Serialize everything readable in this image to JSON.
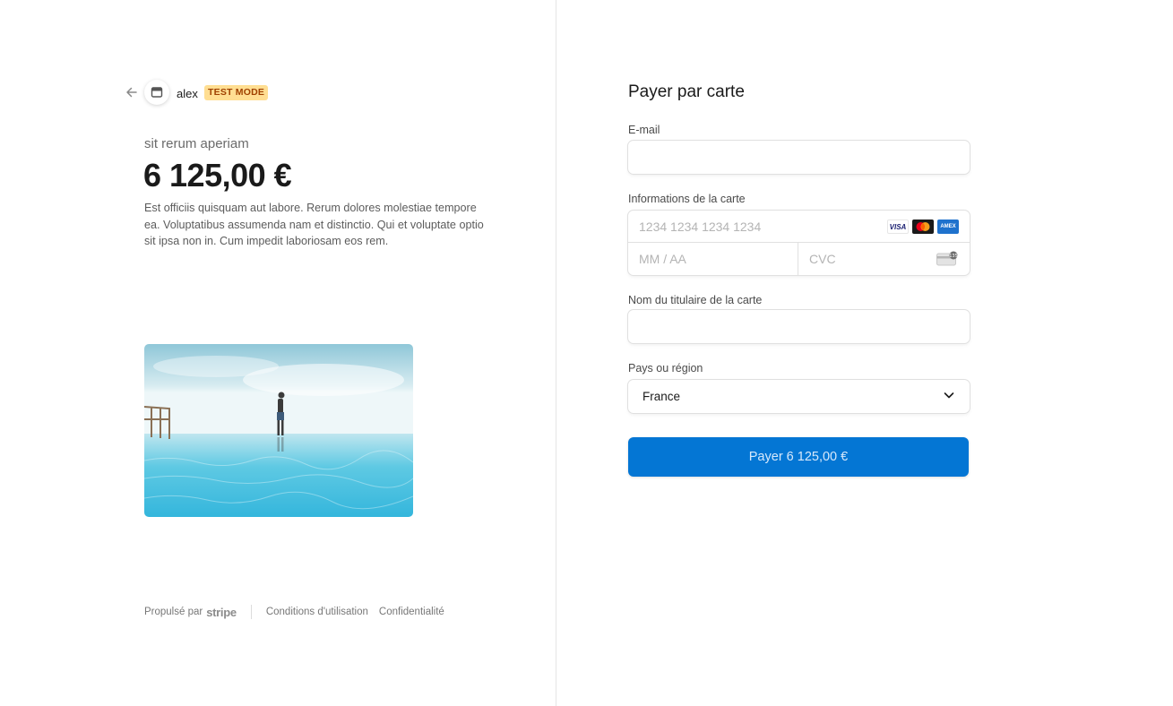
{
  "merchant": {
    "name": "alex",
    "badge": "TEST MODE"
  },
  "product": {
    "name": "sit rerum aperiam",
    "price": "6 125,00 €",
    "description": "Est officiis quisquam aut labore. Rerum dolores molestiae tempore ea. Voluptatibus assumenda nam et distinctio. Qui et voluptate optio sit ipsa non in. Cum impedit laboriosam eos rem."
  },
  "footer": {
    "powered_by": "Propulsé par",
    "brand": "stripe",
    "terms": "Conditions d'utilisation",
    "privacy": "Confidentialité"
  },
  "form": {
    "title": "Payer par carte",
    "email_label": "E-mail",
    "email_value": "",
    "card_label": "Informations de la carte",
    "card_number_placeholder": "1234 1234 1234 1234",
    "expiry_placeholder": "MM / AA",
    "cvc_placeholder": "CVC",
    "card_brands": [
      "visa-icon",
      "mastercard-icon",
      "amex-icon"
    ],
    "name_label": "Nom du titulaire de la carte",
    "name_value": "",
    "country_label": "Pays ou région",
    "country_value": "France",
    "pay_button": "Payer 6 125,00 €"
  },
  "colors": {
    "accent": "#0074d4",
    "badge_bg": "#ffde92",
    "badge_text": "#a04100"
  }
}
